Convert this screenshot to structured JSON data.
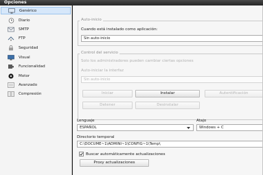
{
  "window": {
    "title": "Opciones"
  },
  "sidebar": {
    "items": [
      {
        "label": "Genérico",
        "icon": "computer-icon",
        "selected": true
      },
      {
        "label": "Diario",
        "icon": "clock-icon"
      },
      {
        "label": "SMTP",
        "icon": "envelope-icon"
      },
      {
        "label": "FTP",
        "icon": "ftp-icon"
      },
      {
        "label": "Seguridad",
        "icon": "lock-icon"
      },
      {
        "label": "Visual",
        "icon": "monitor-icon"
      },
      {
        "label": "Funcionalidad",
        "icon": "puzzle-icon"
      },
      {
        "label": "Motor",
        "icon": "gear-icon"
      },
      {
        "label": "Avanzado",
        "icon": "advanced-icon"
      },
      {
        "label": "Compresión",
        "icon": "archive-icon"
      }
    ]
  },
  "autostart": {
    "legend": "Auto-inicio",
    "installed_label": "Cuando está instalado como aplicación:",
    "installed_value": "Sin auto-inicio"
  },
  "service": {
    "legend": "Control del servicio",
    "admins_only_label": "Solo los administradores pueden cambiar ciertas opciones",
    "autostart_ui_label": "Auto-iniciar la interfaz",
    "autostart_ui_value": "Sin auto-inicio",
    "buttons": {
      "start": "Iniciar",
      "install": "Instalar",
      "authentication": "Autentificación",
      "stop": "Detener",
      "uninstall": "Desinstalar"
    }
  },
  "language": {
    "label": "Lenguaje",
    "value": "ESPAÑOL"
  },
  "shortcut": {
    "label": "Atajo",
    "value": "Windows + C"
  },
  "temp_dir": {
    "label": "Directorio temporal",
    "value": "C:\\DOCUME~1\\ADMINI~1\\CONFIG~1\\Temp\\"
  },
  "updates": {
    "auto_check_label": "Buscar automáticamente actualizaciones",
    "auto_check_checked": true,
    "proxy_button": "Proxy actualizaciones"
  },
  "colors": {
    "selected_bg": "#d6e7fa",
    "titlebar": "#2e2e2e"
  }
}
